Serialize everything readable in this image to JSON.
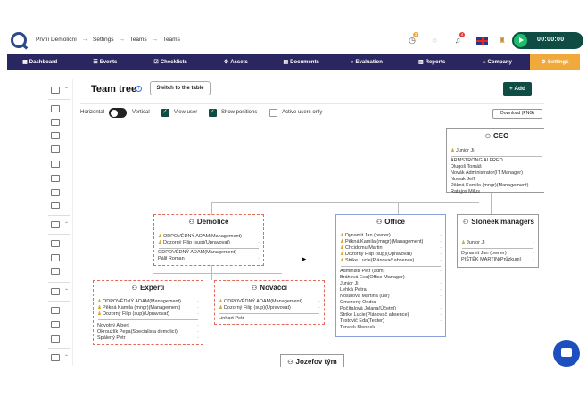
{
  "breadcrumbs": [
    "První Demoliční",
    "Settings",
    "Teams",
    "Teams"
  ],
  "breadcrumb_sep": "→",
  "topbar": {
    "timer_badge": "3",
    "notif_badge": "4",
    "timer": "00:00:00"
  },
  "nav": [
    {
      "label": "Dashboard",
      "icon": "▦"
    },
    {
      "label": "Events",
      "icon": "☰"
    },
    {
      "label": "Checklists",
      "icon": "☑"
    },
    {
      "label": "Assets",
      "icon": "⚙"
    },
    {
      "label": "Documents",
      "icon": "▤"
    },
    {
      "label": "Evaluation",
      "icon": "◑"
    },
    {
      "label": "Reports",
      "icon": "▥"
    },
    {
      "label": "Company",
      "icon": "⌂"
    },
    {
      "label": "Settings",
      "icon": "⚙"
    }
  ],
  "page": {
    "title": "Team tree",
    "switch_label": "Switch to the table",
    "add_label": "+ Add",
    "horizontal": "Horizontal",
    "vertical": "Vertical",
    "view_user": "View user",
    "show_positions": "Show positions",
    "active_users_only": "Active users only",
    "download": "Download (PNG)"
  },
  "cards": {
    "ceo": {
      "title": "CEO",
      "top": [
        "Junior Ji"
      ],
      "members": [
        "ARMSTRONG ALFRED",
        "Dlugoš Tomáš",
        "Novák Administrator(IT Manager)",
        "Nowak Jeff",
        "Pěkná Kamila (mngr)(Management)",
        "Ratajos Milus"
      ]
    },
    "demolice": {
      "title": "Demolice",
      "top": [
        "ODPOVĚDNÝ ADAM(Management)",
        "Dozorný Filip (sup)(Upravovat)"
      ],
      "members": [
        "ODPOVĚDNÝ ADAM(Management)",
        "Pálil Roman"
      ]
    },
    "office": {
      "title": "Office",
      "top": [
        "Dynamit Jan (owner)",
        "Pěkná Kamila (mngr)(Management)",
        "Chcidomu Martin",
        "Dozorný Filip (sup)(Upravovat)",
        "Strike Lucie(Plánovač absence)"
      ],
      "members": [
        "Administr Petr (adm)",
        "Bráhová Eva(Office Manager)",
        "Junior Ji",
        "Lehká Petra",
        "Nosálová Martina (usr)",
        "Omezený Ondra",
        "Počítalová Jolana(Účetní)",
        "Strike Lucie(Plánovač absence)",
        "Testovič Eda(Tester)",
        "Toneek Sloneek"
      ]
    },
    "sloneek": {
      "title": "Sloneek managers",
      "top": [
        "Junior Ji"
      ],
      "members": [
        "Dynamit Jan (owner)",
        "PIŠTĚK MARTIN(Průzkum)"
      ]
    },
    "experti": {
      "title": "Experti",
      "top": [
        "ODPOVĚDNÝ ADAM(Management)",
        "Pěkná Kamila (mngr)(Management)",
        "Dozorný Filip (sup)(Upravovat)"
      ],
      "members": [
        "Novotný Albert",
        "Okroužlík Pepa(Specialista demolicí)",
        "Spálený Petr"
      ]
    },
    "novacci": {
      "title": "Nováčci",
      "top": [
        "ODPOVĚDNÝ ADAM(Management)",
        "Dozorný Filip (sup)(Upravovat)"
      ],
      "members": [
        "Linhart Petr"
      ]
    },
    "jozefov": {
      "title": "Jozefov tým"
    }
  }
}
